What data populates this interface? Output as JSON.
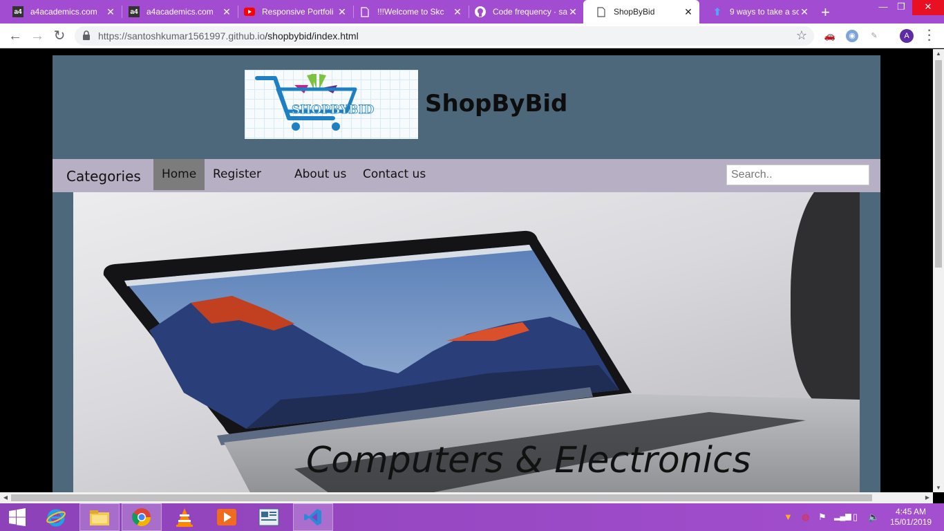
{
  "browser": {
    "tabs": [
      {
        "title": "a4academics.com",
        "icon": "a4academics-favicon",
        "active": false
      },
      {
        "title": "a4academics.com",
        "icon": "a4academics-favicon",
        "active": false
      },
      {
        "title": "Responsive Portfoli",
        "icon": "youtube-icon",
        "active": false
      },
      {
        "title": "!!!Welcome to Skc",
        "icon": "document-icon",
        "active": false
      },
      {
        "title": "Code frequency · sa",
        "icon": "github-icon",
        "active": false
      },
      {
        "title": "ShopByBid",
        "icon": "document-icon",
        "active": true
      },
      {
        "title": "9 ways to take a sc",
        "icon": "download-icon",
        "active": false
      }
    ],
    "url_host": "https://santoshkumar1561997.github.io",
    "url_path": "/shopbybid/index.html",
    "profile_initial": "A"
  },
  "site": {
    "logo_text": "SHOPBYBID",
    "title": "ShopByBid",
    "nav": {
      "categories": "Categories",
      "home": "Home",
      "register": "Register",
      "about": "About us",
      "contact": "Contact us",
      "search_placeholder": "Search.."
    },
    "hero_caption": "Computers & Electronics"
  },
  "taskbar": {
    "apps": [
      "windows-start",
      "internet-explorer",
      "file-explorer",
      "chrome",
      "vlc",
      "media-player",
      "news-app",
      "vscode"
    ],
    "clock_time": "4:45 AM",
    "clock_date": "15/01/2019"
  },
  "colors": {
    "tab_bar": "#a24dd1",
    "site_bg": "#4e687b",
    "nav_bg": "#b7afc3",
    "nav_active": "#7d7c7d"
  }
}
